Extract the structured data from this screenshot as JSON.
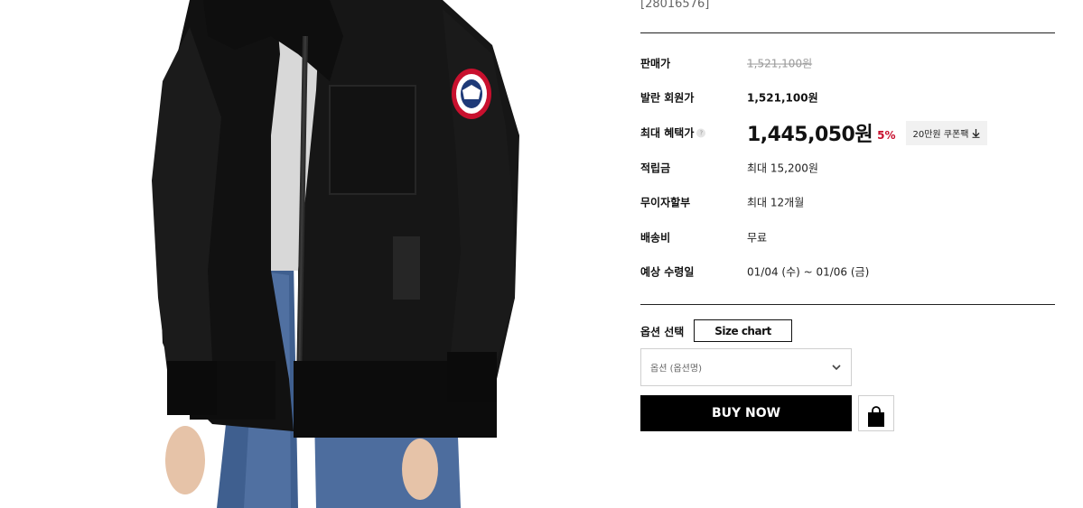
{
  "product": {
    "code": "[28016576]",
    "image_alt": "black fleece bomber jacket with hood"
  },
  "price_rows": {
    "sale_price": {
      "label": "판매가",
      "value": "1,521,100원"
    },
    "member_price": {
      "label": "발란 회원가",
      "value": "1,521,100원"
    },
    "max_benefit": {
      "label": "최대 혜택가",
      "help_glyph": "?",
      "value": "1,445,050원",
      "discount": "5%",
      "coupon_label": "20만원 쿠폰팩",
      "coupon_icon": "download-arrow-icon"
    },
    "points": {
      "label": "적립금",
      "value": "최대 15,200원"
    },
    "installment": {
      "label": "무이자할부",
      "value": "최대 12개월"
    },
    "shipping": {
      "label": "배송비",
      "value": "무료"
    },
    "delivery": {
      "label": "예상 수령일",
      "value": "01/04 (수) ~ 01/06 (금)"
    }
  },
  "options": {
    "label": "옵션 선택",
    "size_chart_label": "Size chart",
    "select_placeholder": "옵션 (옵션명)",
    "select_icon": "chevron-down-icon"
  },
  "actions": {
    "buy_now_label": "BUY NOW",
    "bag_icon": "shopping-bag-icon"
  },
  "colors": {
    "discount_red": "#c8102e",
    "buy_button_bg": "#000000",
    "coupon_bg": "#f1f1f1"
  }
}
